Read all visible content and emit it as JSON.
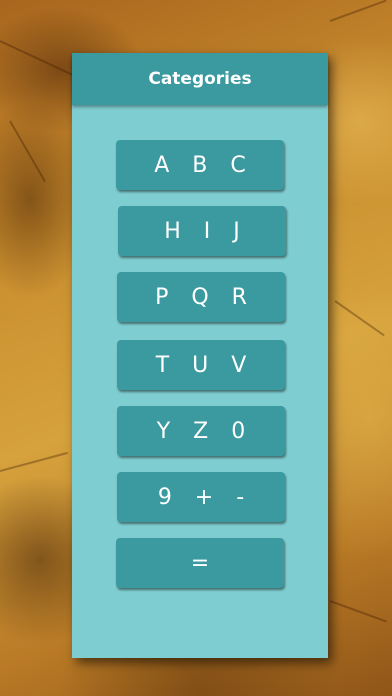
{
  "panel": {
    "title": "Categories"
  },
  "categories": [
    {
      "label": "A B C"
    },
    {
      "label": "H I J"
    },
    {
      "label": "P Q R"
    },
    {
      "label": "T U V"
    },
    {
      "label": "Y Z 0"
    },
    {
      "label": "9 + -"
    },
    {
      "label": "="
    }
  ],
  "colors": {
    "panel_background": "#7ecdd0",
    "header_background": "#3a9aa0",
    "button_background": "#3a9aa0",
    "text": "#ffffff"
  }
}
